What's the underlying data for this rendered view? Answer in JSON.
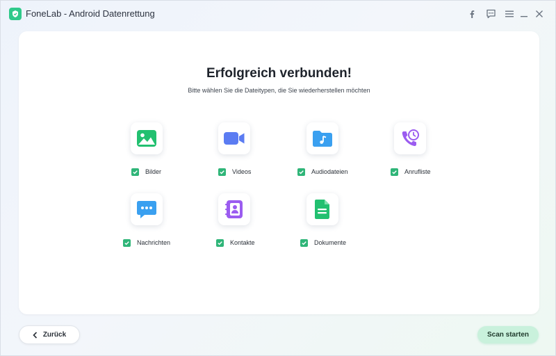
{
  "window": {
    "title": "FoneLab - Android Datenrettung"
  },
  "controls": {
    "icons": [
      "facebook-icon",
      "feedback-icon",
      "menu-icon",
      "minimize-icon",
      "close-icon"
    ]
  },
  "main": {
    "heading": "Erfolgreich verbunden!",
    "subheading": "Bitte wählen Sie die Dateitypen, die Sie wiederherstellen möchten",
    "types": [
      {
        "label": "Bilder",
        "checked": true,
        "icon": "image-icon",
        "color": "#22c070"
      },
      {
        "label": "Videos",
        "checked": true,
        "icon": "video-camera-icon",
        "color": "#5b7cf2"
      },
      {
        "label": "Audiodateien",
        "checked": true,
        "icon": "audio-folder-icon",
        "color": "#3aa0f0"
      },
      {
        "label": "Anrufliste",
        "checked": true,
        "icon": "call-history-icon",
        "color": "#9b5cf0"
      },
      {
        "label": "Nachrichten",
        "checked": true,
        "icon": "message-icon",
        "color": "#3aa0f0"
      },
      {
        "label": "Kontakte",
        "checked": true,
        "icon": "contacts-icon",
        "color": "#9b5cf0"
      },
      {
        "label": "Dokumente",
        "checked": true,
        "icon": "document-icon",
        "color": "#22c070"
      }
    ]
  },
  "footer": {
    "back_label": "Zurück",
    "scan_label": "Scan starten"
  },
  "colors": {
    "accent": "#2fb578",
    "scan_button": "#c9f1dc"
  }
}
